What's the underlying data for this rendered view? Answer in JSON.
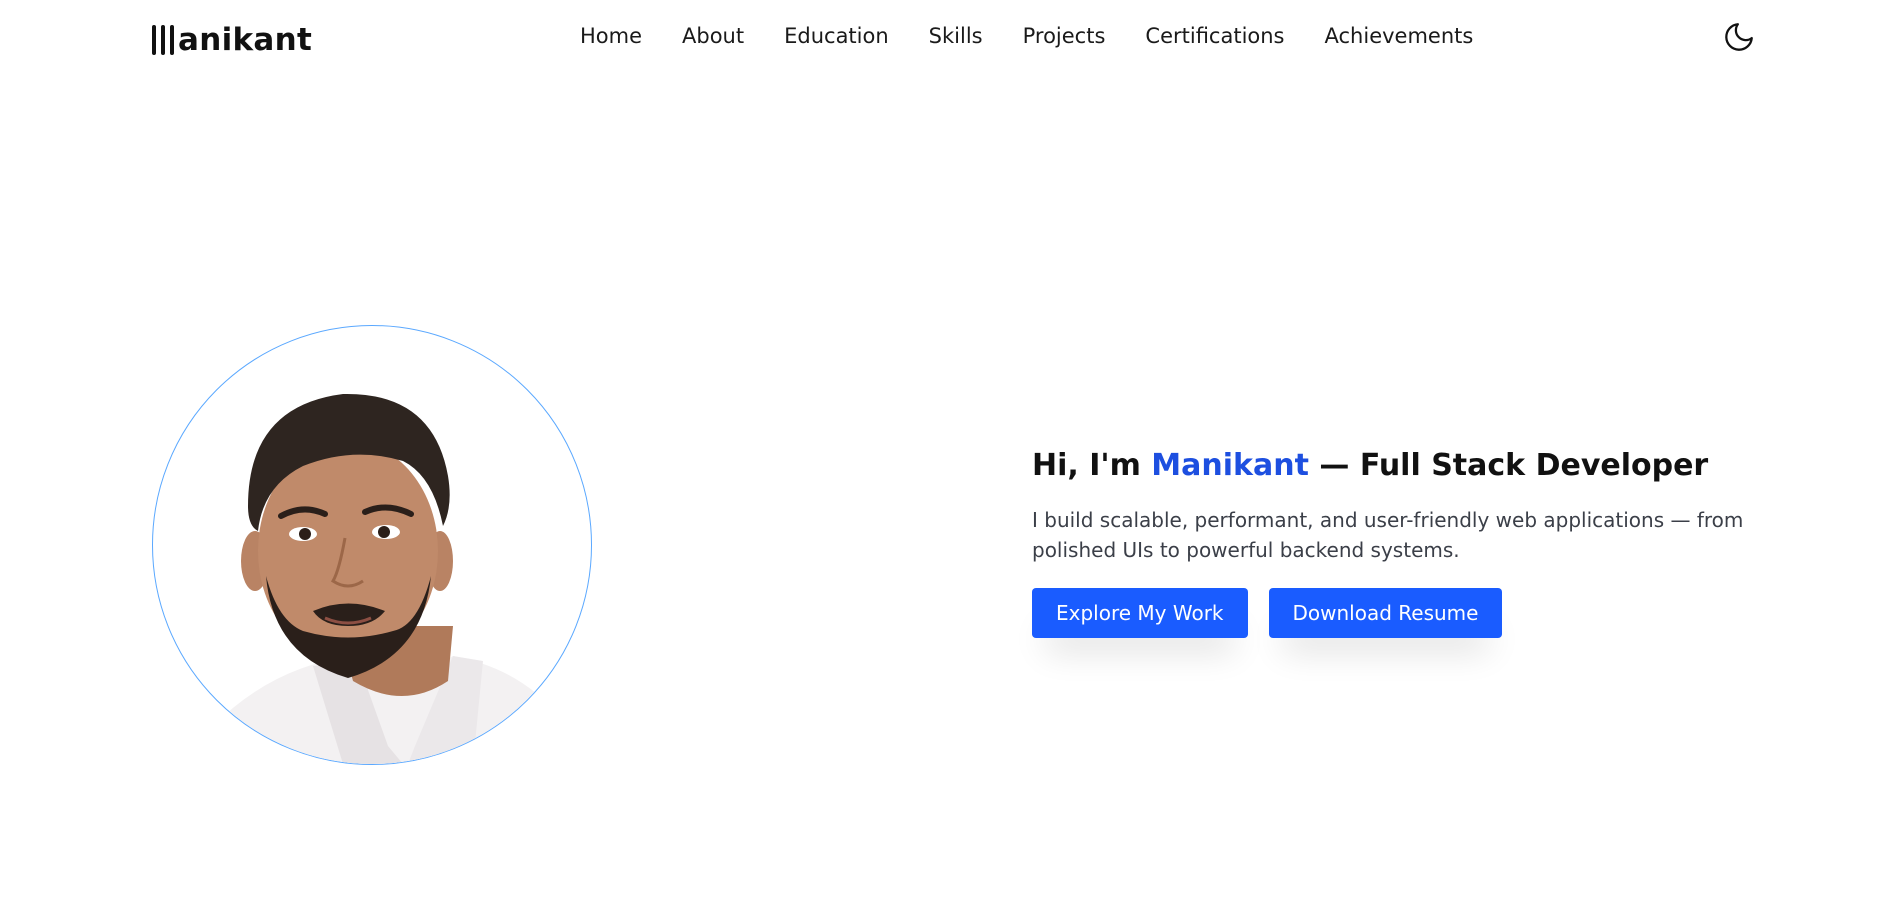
{
  "brand": {
    "logo_text": "anikant"
  },
  "nav": {
    "items": [
      {
        "label": "Home"
      },
      {
        "label": "About"
      },
      {
        "label": "Education"
      },
      {
        "label": "Skills"
      },
      {
        "label": "Projects"
      },
      {
        "label": "Certifications"
      },
      {
        "label": "Achievements"
      }
    ],
    "theme_toggle_icon": "moon-icon"
  },
  "hero": {
    "greeting": "Hi, I'm ",
    "name": "Manikant",
    "role": " — Full Stack Developer",
    "description": "I build scalable, performant, and user-friendly web applications — from polished UIs to powerful backend systems.",
    "primary_button": "Explore My Work",
    "secondary_button": "Download Resume"
  },
  "colors": {
    "accent": "#1a5cff",
    "name_highlight": "#1d4fe0",
    "avatar_border": "#5aa8ff"
  }
}
